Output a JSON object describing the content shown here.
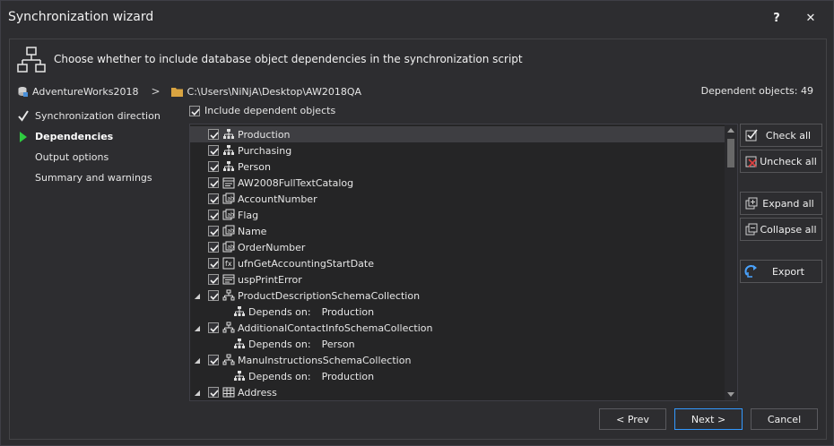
{
  "window": {
    "title": "Synchronization wizard",
    "help_label": "?",
    "close_label": "✕"
  },
  "header": {
    "text": "Choose whether to include database object dependencies in the synchronization script",
    "icon": "dependency-tree-icon"
  },
  "path": {
    "database": "AdventureWorks2018",
    "separator": ">",
    "folder": "C:\\Users\\NiNjA\\Desktop\\AW2018QA",
    "dependent_count": "Dependent objects: 49"
  },
  "steps": [
    {
      "label": "Synchronization direction",
      "state": "done"
    },
    {
      "label": "Dependencies",
      "state": "active"
    },
    {
      "label": "Output options",
      "state": "pending"
    },
    {
      "label": "Summary and warnings",
      "state": "pending"
    }
  ],
  "include_checkbox": {
    "label": "Include dependent objects",
    "checked": true
  },
  "tree": {
    "items": [
      {
        "label": "Production",
        "icon": "schema-icon",
        "checked": true,
        "expander": "",
        "selected": true
      },
      {
        "label": "Purchasing",
        "icon": "schema-icon",
        "checked": true,
        "expander": ""
      },
      {
        "label": "Person",
        "icon": "schema-icon",
        "checked": true,
        "expander": ""
      },
      {
        "label": "AW2008FullTextCatalog",
        "icon": "fulltext-catalog-icon",
        "checked": true,
        "expander": ""
      },
      {
        "label": "AccountNumber",
        "icon": "user-defined-type-icon",
        "checked": true,
        "expander": ""
      },
      {
        "label": "Flag",
        "icon": "user-defined-type-icon",
        "checked": true,
        "expander": ""
      },
      {
        "label": "Name",
        "icon": "user-defined-type-icon",
        "checked": true,
        "expander": ""
      },
      {
        "label": "OrderNumber",
        "icon": "user-defined-type-icon",
        "checked": true,
        "expander": ""
      },
      {
        "label": "ufnGetAccountingStartDate",
        "icon": "function-icon",
        "checked": true,
        "expander": ""
      },
      {
        "label": "uspPrintError",
        "icon": "procedure-icon",
        "checked": true,
        "expander": ""
      },
      {
        "label": "ProductDescriptionSchemaCollection",
        "icon": "xml-schema-icon",
        "checked": true,
        "expander": "◢"
      },
      {
        "depends_label": "Depends on:",
        "depends_value": "Production",
        "icon": "schema-icon"
      },
      {
        "label": "AdditionalContactInfoSchemaCollection",
        "icon": "xml-schema-icon",
        "checked": true,
        "expander": "◢"
      },
      {
        "depends_label": "Depends on:",
        "depends_value": "Person",
        "icon": "schema-icon"
      },
      {
        "label": "ManuInstructionsSchemaCollection",
        "icon": "xml-schema-icon",
        "checked": true,
        "expander": "◢"
      },
      {
        "depends_label": "Depends on:",
        "depends_value": "Production",
        "icon": "schema-icon"
      },
      {
        "label": "Address",
        "icon": "table-icon",
        "checked": true,
        "expander": "◢"
      }
    ]
  },
  "side_buttons": {
    "check_all": "Check all",
    "uncheck_all": "Uncheck all",
    "expand_all": "Expand all",
    "collapse_all": "Collapse all",
    "export": "Export"
  },
  "footer": {
    "prev": "< Prev",
    "next": "Next >",
    "cancel": "Cancel"
  },
  "colors": {
    "background": "#2d2d30",
    "accent": "#3399ff",
    "active_step_arrow": "#2ecc40",
    "schema_icon": "#e0e0e0"
  }
}
